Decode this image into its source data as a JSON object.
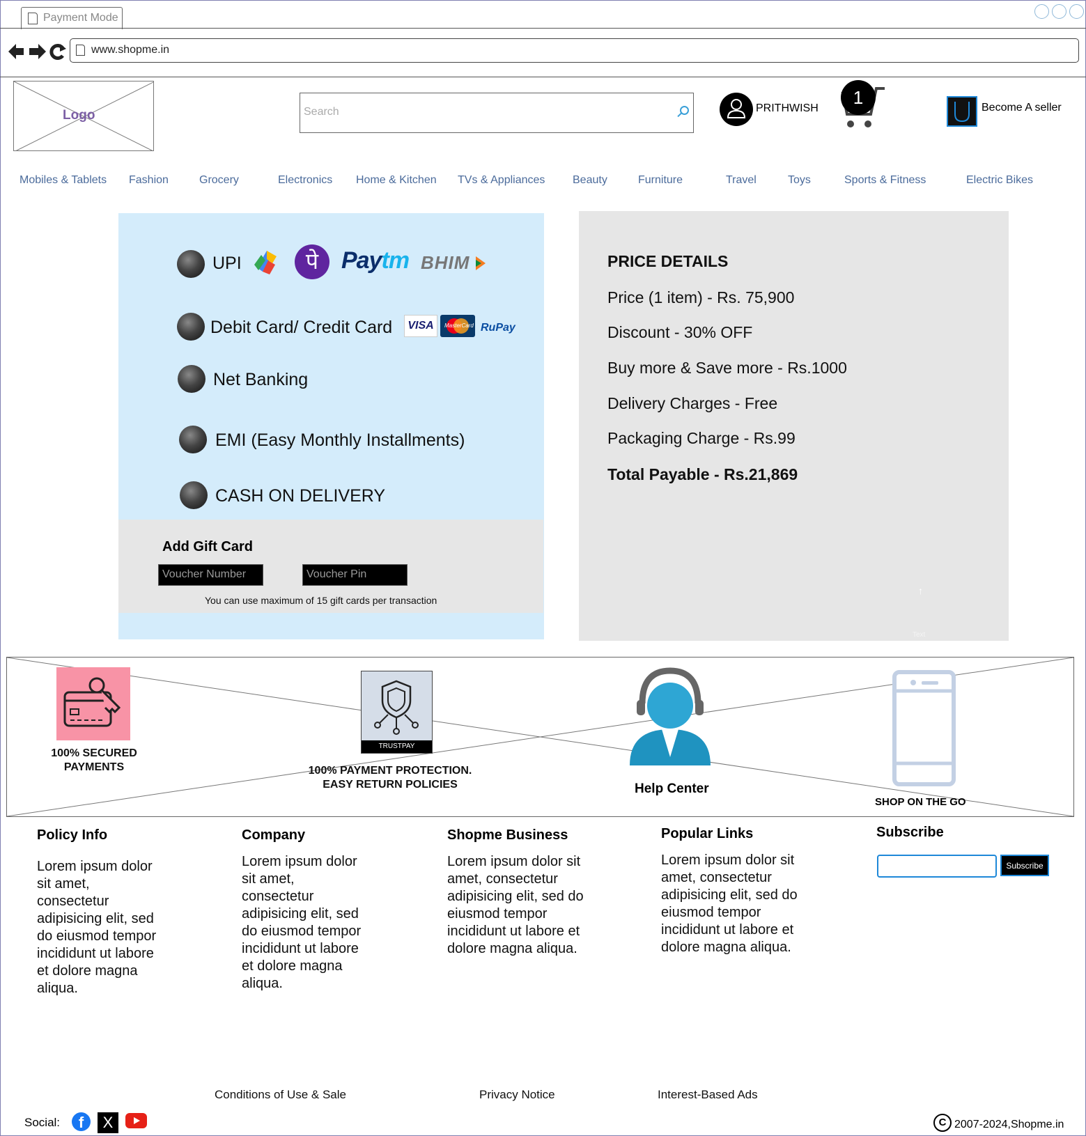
{
  "browser": {
    "tab_title": "Payment Mode",
    "url": "www.shopme.in"
  },
  "header": {
    "logo_text": "Logo",
    "search_placeholder": "Search",
    "user_name": "PRITHWISH",
    "cart_count": "1",
    "seller_label": "Become  A seller"
  },
  "categories": [
    "Mobiles & Tablets",
    "Fashion",
    "Grocery",
    "Electronics",
    "Home & Kitchen",
    "TVs & Appliances",
    "Beauty",
    "Furniture",
    "Travel",
    "Toys",
    "Sports & Fitness",
    "Electric Bikes"
  ],
  "payment": {
    "options": [
      "UPI",
      "Debit Card/ Credit Card",
      "Net Banking",
      "EMI (Easy Monthly Installments)",
      "CASH ON DELIVERY"
    ],
    "upi_brands": {
      "phonepe": "पे",
      "paytm_a": "Pay",
      "paytm_b": "tm",
      "bhim": "BHIM"
    },
    "card_brands": {
      "visa": "VISA",
      "mastercard": "MasterCard",
      "rupay": "RuPay"
    }
  },
  "gift_card": {
    "title": "Add Gift Card",
    "voucher_number_placeholder": "Voucher Number",
    "voucher_pin_placeholder": "Voucher Pin",
    "note": "You can use maximum of 15 gift cards per transaction"
  },
  "price_details": {
    "title": "PRICE DETAILS",
    "lines": [
      "Price (1 item) - Rs. 75,900",
      "Discount - 30% OFF",
      "Buy more & Save more - Rs.1000",
      "Delivery Charges - Free",
      "Packaging Charge - Rs.99"
    ],
    "total": "Total Payable - Rs.21,869",
    "placeholder_text": "Text"
  },
  "trust": {
    "secured": [
      "100% SECURED",
      "PAYMENTS"
    ],
    "trustpay_badge": "TRUSTPAY",
    "protection": [
      "100% PAYMENT PROTECTION.",
      "EASY RETURN POLICIES"
    ],
    "help": "Help Center",
    "shop": "SHOP ON THE GO"
  },
  "footer": {
    "columns": [
      {
        "title": "Policy Info",
        "lines": [
          "Lorem ipsum dolor",
          "sit amet,",
          "consectetur",
          "adipisicing elit, sed",
          "do eiusmod tempor",
          "incididunt ut labore",
          "et dolore magna",
          "aliqua."
        ]
      },
      {
        "title": "Company",
        "lines": [
          "Lorem ipsum dolor",
          "sit amet,",
          "consectetur",
          "adipisicing elit, sed",
          "do eiusmod tempor",
          "incididunt ut labore",
          "et dolore magna",
          "aliqua."
        ]
      },
      {
        "title": "Shopme Business",
        "lines": [
          "Lorem ipsum dolor sit",
          "amet, consectetur",
          "adipisicing elit, sed do",
          "eiusmod tempor",
          "incididunt ut labore et",
          "dolore magna aliqua."
        ]
      },
      {
        "title": "Popular Links",
        "lines": [
          "Lorem ipsum dolor sit",
          "amet, consectetur",
          "adipisicing elit, sed do",
          "eiusmod tempor",
          "incididunt ut labore et",
          "dolore magna aliqua."
        ]
      }
    ],
    "subscribe_title": "Subscribe",
    "subscribe_button": "Subscribe",
    "legal_links": [
      "Conditions of Use & Sale",
      "Privacy Notice",
      "Interest-Based Ads"
    ],
    "social_label": "Social:",
    "social_glyphs": {
      "facebook": "f",
      "x": "X"
    },
    "copyright_symbol": "C",
    "copyright": "2007-2024,Shopme.in"
  },
  "colors": {
    "payment_panel": "#d4ecfb",
    "price_panel": "#e6e6e6",
    "category_link": "#4b6b9b",
    "accent": "#1e88d8"
  }
}
